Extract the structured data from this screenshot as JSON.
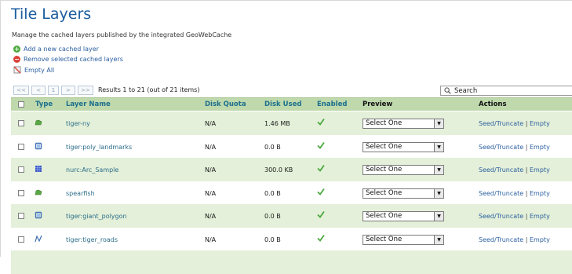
{
  "page": {
    "title": "Tile Layers",
    "description": "Manage the cached layers published by the integrated GeoWebCache"
  },
  "actions": {
    "add": "Add a new cached layer",
    "remove": "Remove selected cached layers",
    "empty_all": "Empty All"
  },
  "pager": {
    "first": "<<",
    "prev": "<",
    "page": "1",
    "next": ">",
    "last": ">>",
    "info": "Results 1 to 21 (out of 21 items)"
  },
  "search": {
    "label": "Search"
  },
  "table": {
    "headers": {
      "type": "Type",
      "name": "Layer Name",
      "quota": "Disk Quota",
      "used": "Disk Used",
      "enabled": "Enabled",
      "preview": "Preview",
      "actions": "Actions"
    },
    "rows": [
      {
        "type_icon": "polygon-layer-icon",
        "name": "tiger-ny",
        "quota": "N/A",
        "used": "1.46 MB",
        "enabled": true,
        "preview": "Select One",
        "seed": "Seed/Truncate",
        "sep": "|",
        "empty": "Empty"
      },
      {
        "type_icon": "point-layer-icon",
        "name": "tiger:poly_landmarks",
        "quota": "N/A",
        "used": "0.0 B",
        "enabled": true,
        "preview": "Select One",
        "seed": "Seed/Truncate",
        "sep": "|",
        "empty": "Empty"
      },
      {
        "type_icon": "raster-layer-icon",
        "name": "nurc:Arc_Sample",
        "quota": "N/A",
        "used": "300.0 KB",
        "enabled": true,
        "preview": "Select One",
        "seed": "Seed/Truncate",
        "sep": "|",
        "empty": "Empty"
      },
      {
        "type_icon": "polygon-layer-icon",
        "name": "spearfish",
        "quota": "N/A",
        "used": "0.0 B",
        "enabled": true,
        "preview": "Select One",
        "seed": "Seed/Truncate",
        "sep": "|",
        "empty": "Empty"
      },
      {
        "type_icon": "point-layer-icon",
        "name": "tiger:giant_polygon",
        "quota": "N/A",
        "used": "0.0 B",
        "enabled": true,
        "preview": "Select One",
        "seed": "Seed/Truncate",
        "sep": "|",
        "empty": "Empty"
      },
      {
        "type_icon": "line-layer-icon",
        "name": "tiger:tiger_roads",
        "quota": "N/A",
        "used": "0.0 B",
        "enabled": true,
        "preview": "Select One",
        "seed": "Seed/Truncate",
        "sep": "|",
        "empty": "Empty"
      }
    ]
  },
  "colors": {
    "title": "#1c5da0",
    "header_bg": "#bfd9ad",
    "row_odd_bg": "#e4f0d9",
    "link": "#2b5fa0",
    "check": "#4aa93d"
  }
}
